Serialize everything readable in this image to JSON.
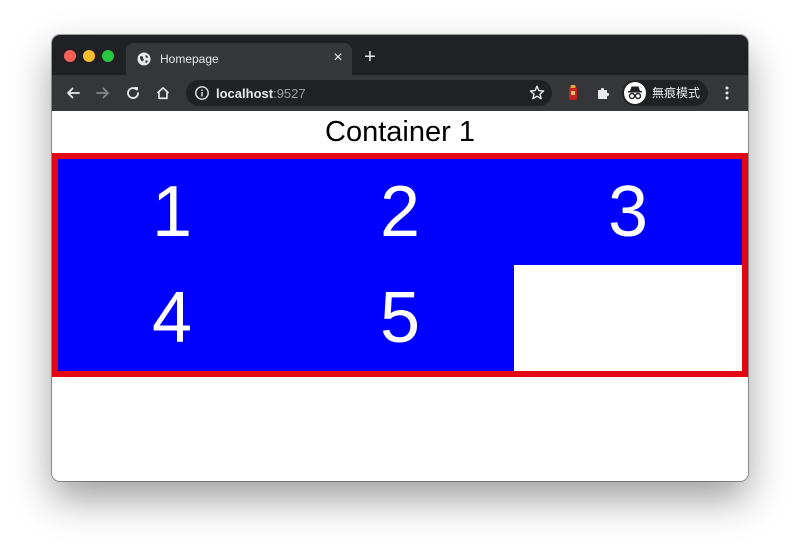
{
  "browser": {
    "tab": {
      "title": "Homepage",
      "close_glyph": "×"
    },
    "new_tab_glyph": "+",
    "address": {
      "host": "localhost",
      "port": ":9527"
    },
    "profile": {
      "label": "無痕模式"
    },
    "icons": {
      "back": "arrow-left-icon",
      "forward": "arrow-right-icon",
      "reload": "reload-icon",
      "home": "home-icon",
      "info": "info-icon",
      "bookmark": "star-icon",
      "extension": "extension-icon",
      "puzzle": "puzzle-icon",
      "incognito": "incognito-icon",
      "menu": "kebab-menu-icon"
    }
  },
  "page": {
    "heading": "Container 1",
    "items": [
      "1",
      "2",
      "3",
      "4",
      "5"
    ]
  },
  "colors": {
    "item_background": "#0000ff",
    "item_text": "#ffffff",
    "container_border": "#e30613",
    "window_chrome": "#202124",
    "toolbar": "#35363a"
  }
}
